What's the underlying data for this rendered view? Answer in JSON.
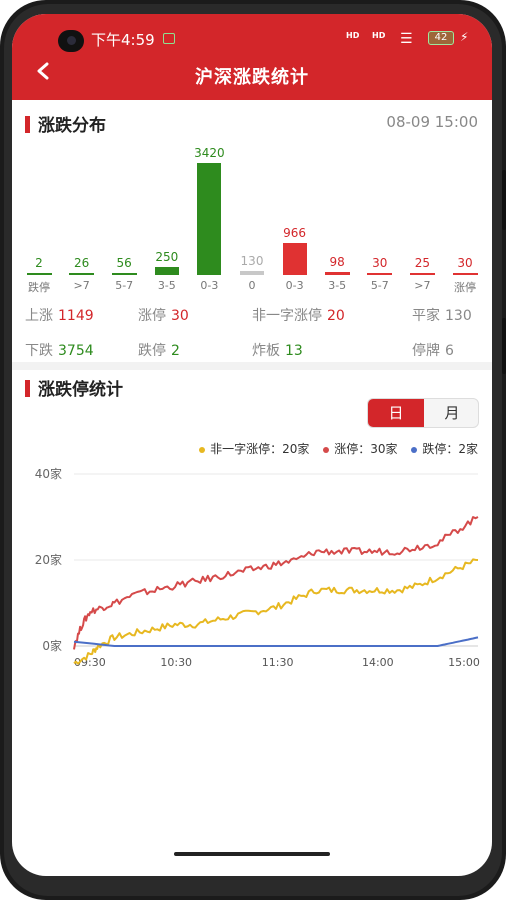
{
  "status_bar": {
    "time": "下午4:59",
    "signal_1": "HD",
    "signal_2": "HD",
    "battery": "42"
  },
  "header": {
    "title": "沪深涨跌统计"
  },
  "distribution": {
    "title": "涨跌分布",
    "datetime": "08-09 15:00"
  },
  "stats": [
    {
      "label": "上涨",
      "value": "1149",
      "color": "#d3262a"
    },
    {
      "label": "涨停",
      "value": "30",
      "color": "#d3262a"
    },
    {
      "label": "非一字涨停",
      "value": "20",
      "color": "#d3262a"
    },
    {
      "label": "平家",
      "value": "130",
      "color": "#888888"
    },
    {
      "label": "下跌",
      "value": "3754",
      "color": "#2e8b1e"
    },
    {
      "label": "跌停",
      "value": "2",
      "color": "#2e8b1e"
    },
    {
      "label": "炸板",
      "value": "13",
      "color": "#2e8b1e"
    },
    {
      "label": "停牌",
      "value": "6",
      "color": "#888888"
    }
  ],
  "limit_stats": {
    "title": "涨跌停统计",
    "toggle": {
      "day": "日",
      "month": "月",
      "active": "day"
    },
    "legend": [
      {
        "label": "非一字涨停：",
        "value": "20家",
        "color": "#e7b821"
      },
      {
        "label": "涨停：",
        "value": "30家",
        "color": "#d54a4a"
      },
      {
        "label": "跌停：",
        "value": "2家",
        "color": "#4b6fc7"
      }
    ]
  },
  "chart_data": [
    {
      "type": "bar",
      "categories": [
        "跌停",
        ">7",
        "5-7",
        "3-5",
        "0-3",
        "0",
        "0-3",
        "3-5",
        "5-7",
        ">7",
        "涨停"
      ],
      "values": [
        2,
        26,
        56,
        250,
        3420,
        130,
        966,
        98,
        30,
        25,
        30
      ],
      "colors": [
        "#2e8b1e",
        "#2e8b1e",
        "#2e8b1e",
        "#2e8b1e",
        "#2e8b1e",
        "#c8c8c8",
        "#e03232",
        "#e03232",
        "#e03232",
        "#e03232",
        "#e03232"
      ],
      "value_colors": [
        "#2e8b1e",
        "#2e8b1e",
        "#2e8b1e",
        "#2e8b1e",
        "#2e8b1e",
        "#aaaaaa",
        "#d3262a",
        "#d3262a",
        "#d3262a",
        "#d3262a",
        "#d3262a"
      ],
      "ylim": [
        0,
        3420
      ]
    },
    {
      "type": "line",
      "x_ticks": [
        "09:30",
        "10:30",
        "11:30",
        "14:00",
        "15:00"
      ],
      "y_ticks": [
        "40家",
        "20家",
        "0家"
      ],
      "ylim": [
        0,
        40
      ],
      "grid": true,
      "series": [
        {
          "name": "非一字涨停",
          "color": "#e7b821",
          "x": [
            0,
            0.04,
            0.06,
            0.1,
            0.15,
            0.2,
            0.25,
            0.3,
            0.35,
            0.4,
            0.45,
            0.5,
            0.55,
            0.6,
            0.65,
            0.7,
            0.75,
            0.8,
            0.85,
            0.9,
            0.95,
            1.0
          ],
          "y": [
            -4,
            -2,
            0,
            2,
            3,
            4,
            5,
            5,
            6,
            7,
            8,
            9,
            11,
            13,
            13,
            13,
            13,
            13,
            14,
            16,
            18,
            20
          ]
        },
        {
          "name": "涨停",
          "color": "#d54a4a",
          "x": [
            0,
            0.02,
            0.04,
            0.07,
            0.1,
            0.15,
            0.2,
            0.25,
            0.3,
            0.35,
            0.4,
            0.45,
            0.5,
            0.55,
            0.6,
            0.65,
            0.7,
            0.75,
            0.8,
            0.85,
            0.9,
            0.95,
            1.0
          ],
          "y": [
            0,
            5,
            8,
            9,
            10,
            12,
            13,
            14,
            15,
            16,
            17,
            18,
            19,
            20,
            22,
            22,
            22,
            22,
            22,
            23,
            24,
            27,
            30
          ]
        },
        {
          "name": "跌停",
          "color": "#4b6fc7",
          "x": [
            0,
            0.1,
            0.5,
            0.75,
            0.8,
            0.85,
            0.9,
            0.95,
            1.0
          ],
          "y": [
            1,
            0,
            0,
            0,
            0,
            0,
            0,
            1,
            2
          ]
        }
      ]
    }
  ]
}
